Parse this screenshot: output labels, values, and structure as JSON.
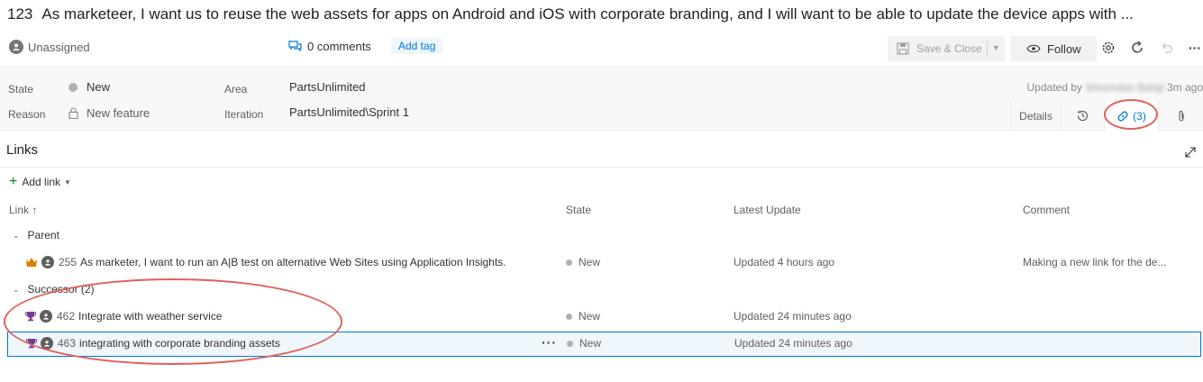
{
  "work_item": {
    "id": "123",
    "title": "As marketeer, I want us to reuse the web assets for apps on Android and iOS with corporate branding, and I will want to be able to update the device apps with ..."
  },
  "toolbar": {
    "assignee": "Unassigned",
    "comments": "0 comments",
    "add_tag": "Add tag",
    "save_close": "Save & Close",
    "follow": "Follow"
  },
  "fields": {
    "state_label": "State",
    "state_value": "New",
    "reason_label": "Reason",
    "reason_value": "New feature",
    "area_label": "Area",
    "area_value": "PartsUnlimited",
    "iteration_label": "Iteration",
    "iteration_value": "PartsUnlimited\\Sprint 1",
    "updated_prefix": "Updated by",
    "updated_user": "Shramdas Balaji",
    "updated_time": "3m ago"
  },
  "tabs": {
    "details": "Details",
    "links": "(3)"
  },
  "links": {
    "title": "Links",
    "add_link": "Add link",
    "columns": {
      "link": "Link ↑",
      "state": "State",
      "latest_update": "Latest Update",
      "comment": "Comment"
    },
    "groups": [
      {
        "name": "Parent",
        "items": [
          {
            "id": "255",
            "title": "As marketer, I want to run an A|B test on alternative Web Sites using Application Insights.",
            "state": "New",
            "latest_update": "Updated 4 hours ago",
            "comment": "Making a new link for the de...",
            "type_icon": "crown-icon"
          }
        ]
      },
      {
        "name": "Successor (2)",
        "items": [
          {
            "id": "462",
            "title": "Integrate with weather service",
            "state": "New",
            "latest_update": "Updated 24 minutes ago",
            "comment": "",
            "type_icon": "trophy-icon"
          },
          {
            "id": "463",
            "title": "integrating with corporate branding assets",
            "state": "New",
            "latest_update": "Updated 24 minutes ago",
            "comment": "",
            "type_icon": "trophy-icon"
          }
        ]
      }
    ]
  },
  "colors": {
    "accent": "#0078d4",
    "annotation_red": "#e0605a",
    "crown_orange": "#e07e00",
    "trophy_purple": "#773b93",
    "add_green": "#107c10"
  }
}
